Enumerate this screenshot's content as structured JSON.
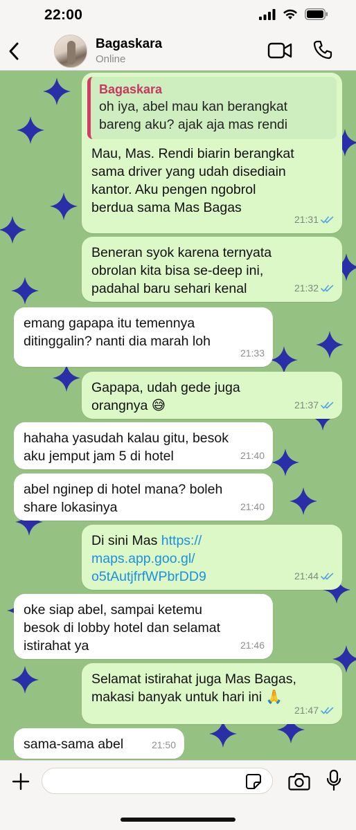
{
  "status_bar": {
    "time": "22:00"
  },
  "header": {
    "contact_name": "Bagaskara",
    "contact_status": "Online"
  },
  "messages": [
    {
      "direction": "outgoing",
      "quote": {
        "author": "Bagaskara",
        "text": "oh iya, abel mau kan berangkat\nbareng aku? ajak aja mas rendi"
      },
      "text": "Mau, Mas. Rendi biarin berangkat\nsama driver yang udah disediain\nkantor. Aku pengen ngobrol\nberdua sama Mas Bagas",
      "time": "21:31",
      "read": true
    },
    {
      "direction": "outgoing",
      "text": "Beneran syok karena ternyata\nobrolan kita bisa se-deep ini,\npadahal baru sehari kenal",
      "time": "21:32",
      "read": true
    },
    {
      "direction": "incoming",
      "text": "emang gapapa itu temennya\nditinggalin? nanti dia marah loh",
      "time": "21:33"
    },
    {
      "direction": "outgoing",
      "text": "Gapapa, udah gede juga\norangnya 😅",
      "time": "21:37",
      "read": true
    },
    {
      "direction": "incoming",
      "text": "hahaha yasudah kalau gitu, besok\naku jemput jam 5 di hotel",
      "time": "21:40"
    },
    {
      "direction": "incoming",
      "text": "abel nginep di hotel mana? boleh\nshare lokasinya",
      "time": "21:40"
    },
    {
      "direction": "outgoing",
      "text_prefix": "Di sini Mas ",
      "link": "https://\nmaps.app.goo.gl/\no5tAutjfrfWPbrDD9",
      "time": "21:44",
      "read": true
    },
    {
      "direction": "incoming",
      "text": "oke siap abel, sampai ketemu\nbesok di lobby hotel dan selamat\nistirahat ya",
      "time": "21:46"
    },
    {
      "direction": "outgoing",
      "text": "Selamat istirahat juga Mas Bagas,\nmakasi banyak untuk hari ini 🙏",
      "time": "21:47",
      "read": true
    },
    {
      "direction": "incoming",
      "text": "sama-sama abel",
      "time": "21:50"
    }
  ],
  "input_bar": {
    "placeholder": ""
  },
  "icons": {
    "back": "chevron-left-icon",
    "video": "video-camera-icon",
    "call": "phone-icon",
    "add": "plus-icon",
    "sticker": "sticker-icon",
    "camera": "camera-icon",
    "mic": "microphone-icon",
    "read_receipt": "double-check-icon"
  },
  "colors": {
    "chat_background": "#95c182",
    "star": "#2a2fa8",
    "outgoing_bubble": "#dcf8c6",
    "incoming_bubble": "#ffffff",
    "quote_accent": "#d23b62",
    "link": "#1d8fe0",
    "read_tick": "#4fa3e6"
  }
}
